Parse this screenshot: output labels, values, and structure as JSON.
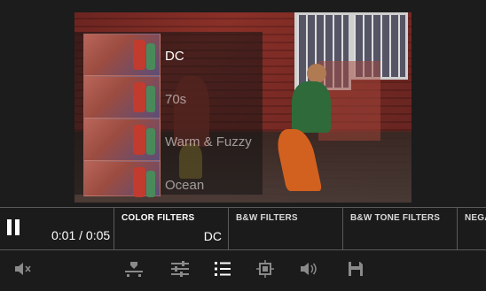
{
  "filters": {
    "items": [
      {
        "label": "DC",
        "selected": true
      },
      {
        "label": "70s",
        "selected": false
      },
      {
        "label": "Warm & Fuzzy",
        "selected": false
      },
      {
        "label": "Ocean",
        "selected": false
      }
    ]
  },
  "player": {
    "time_display": "0:01 / 0:05",
    "state": "playing"
  },
  "tabs": [
    {
      "title": "COLOR FILTERS",
      "value": "DC",
      "active": true
    },
    {
      "title": "B&W FILTERS",
      "value": "",
      "active": false
    },
    {
      "title": "B&W TONE FILTERS",
      "value": "",
      "active": false
    },
    {
      "title": "NEGA",
      "value": "",
      "active": false
    }
  ],
  "toolbar": {
    "icons": [
      "mute-icon",
      "trim-icon",
      "adjust-icon",
      "list-icon",
      "crop-icon",
      "volume-icon",
      "save-icon"
    ]
  }
}
